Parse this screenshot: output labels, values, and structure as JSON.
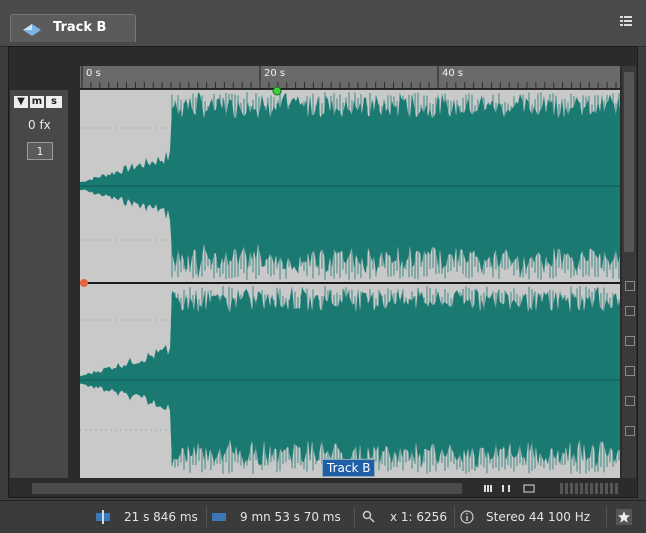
{
  "window": {
    "tab_title": "Track B",
    "menu_icon": "list-menu-icon"
  },
  "track": {
    "controls": [
      "▼",
      "m",
      "s"
    ],
    "fx_label": "0 fx",
    "channel_number": "1",
    "clip_label": "Track B"
  },
  "ruler": {
    "labels": [
      "0 s",
      "20 s",
      "40 s"
    ]
  },
  "status": {
    "cursor_position": "21 s 846 ms",
    "duration": "9 mn 53 s 70 ms",
    "zoom": "x 1: 6256",
    "format": "Stereo 44 100 Hz"
  },
  "colors": {
    "waveform": "#1a7a72",
    "waveform_bg": "#c9c9c9",
    "selection": "#1f5fa8"
  }
}
